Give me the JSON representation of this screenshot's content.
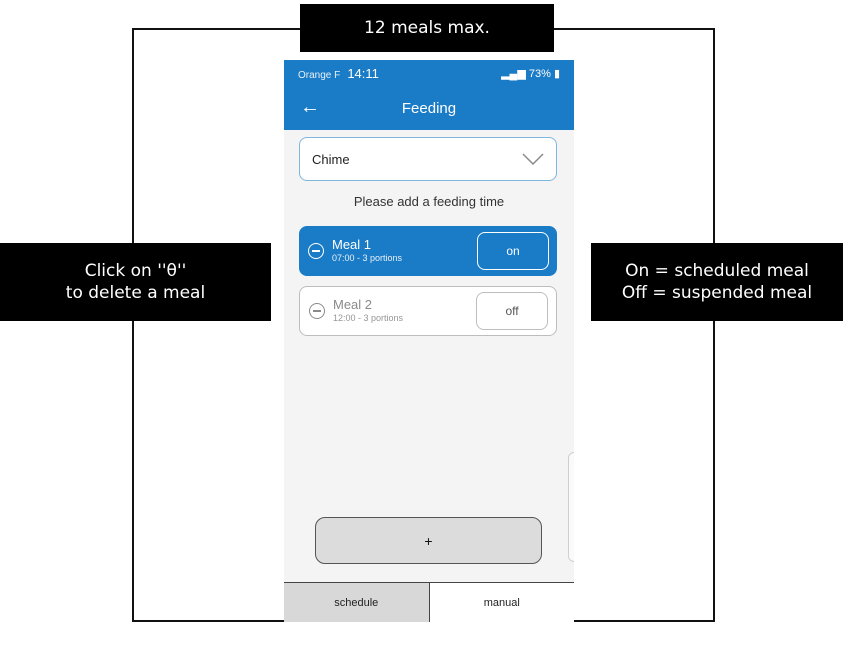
{
  "callouts": {
    "top": "12 meals max.",
    "left_line1": "Click on ''θ''",
    "left_line2": "to delete a meal",
    "right_line1": "On = scheduled meal",
    "right_line2": "Off = suspended meal"
  },
  "statusbar": {
    "carrier": "Orange F",
    "time": "14:11",
    "battery": "73%"
  },
  "appbar": {
    "title": "Feeding",
    "back_icon": "arrow-left-icon"
  },
  "dropdown": {
    "value": "Chime",
    "icon": "chevron-down-icon"
  },
  "hint": "Please add a feeding time",
  "meals": [
    {
      "name": "Meal 1",
      "detail": "07:00 - 3 portions",
      "toggle": "on"
    },
    {
      "name": "Meal 2",
      "detail": "12:00 - 3 portions",
      "toggle": "off"
    }
  ],
  "add_button": "+",
  "tabs": [
    "schedule",
    "manual"
  ],
  "colors": {
    "primary": "#1a7bc6",
    "callout_bg": "#000000"
  }
}
